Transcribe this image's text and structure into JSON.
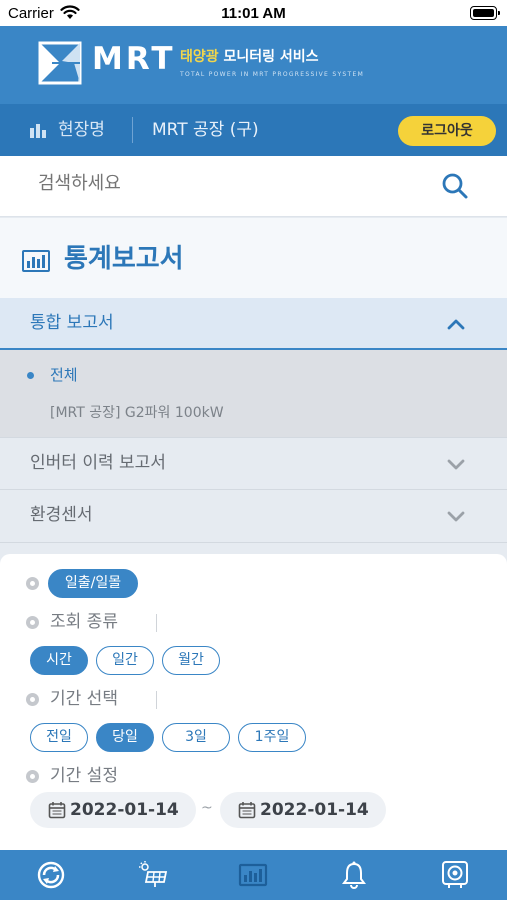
{
  "status_bar": {
    "carrier": "Carrier",
    "time": "11:01 AM"
  },
  "header": {
    "logo_text": "MRT",
    "title_highlight": "태양광",
    "title_rest": " 모니터링 서비스",
    "subtitle": "TOTAL POWER IN MRT PROGRESSIVE SYSTEM"
  },
  "site_bar": {
    "label": "현장명",
    "site_name": "MRT 공장 (구)",
    "logout_label": "로그아웃"
  },
  "search": {
    "placeholder": "검색하세요"
  },
  "page_title": "통계보고서",
  "accordion": {
    "open_section": {
      "label": "통합 보고서",
      "items": [
        {
          "label": "전체",
          "selected": true
        },
        {
          "label": "[MRT 공장] G2파워 100kW",
          "selected": false
        }
      ]
    },
    "collapsed_sections": [
      {
        "label": "인버터 이력 보고서"
      },
      {
        "label": "환경센서"
      }
    ]
  },
  "filters": {
    "sunrise_label": "일출/일몰",
    "query_type": {
      "label": "조회 종류",
      "options": [
        {
          "label": "시간",
          "active": true
        },
        {
          "label": "일간",
          "active": false
        },
        {
          "label": "월간",
          "active": false
        }
      ]
    },
    "period_select": {
      "label": "기간 선택",
      "options": [
        {
          "label": "전일",
          "active": false
        },
        {
          "label": "당일",
          "active": true
        },
        {
          "label": "3일",
          "active": false
        },
        {
          "label": "1주일",
          "active": false
        }
      ]
    },
    "period_setting": {
      "label": "기간 설정",
      "start_date": "2022-01-14",
      "separator": "~",
      "end_date": "2022-01-14"
    }
  },
  "bottom_nav": [
    {
      "icon": "refresh-icon"
    },
    {
      "icon": "solar-panel-icon"
    },
    {
      "icon": "report-chart-icon",
      "active": true
    },
    {
      "icon": "bell-icon"
    },
    {
      "icon": "settings-device-icon"
    }
  ],
  "colors": {
    "brand_blue": "#3a86c6",
    "dark_blue": "#2c77b8",
    "accent_yellow": "#f5d23a"
  }
}
